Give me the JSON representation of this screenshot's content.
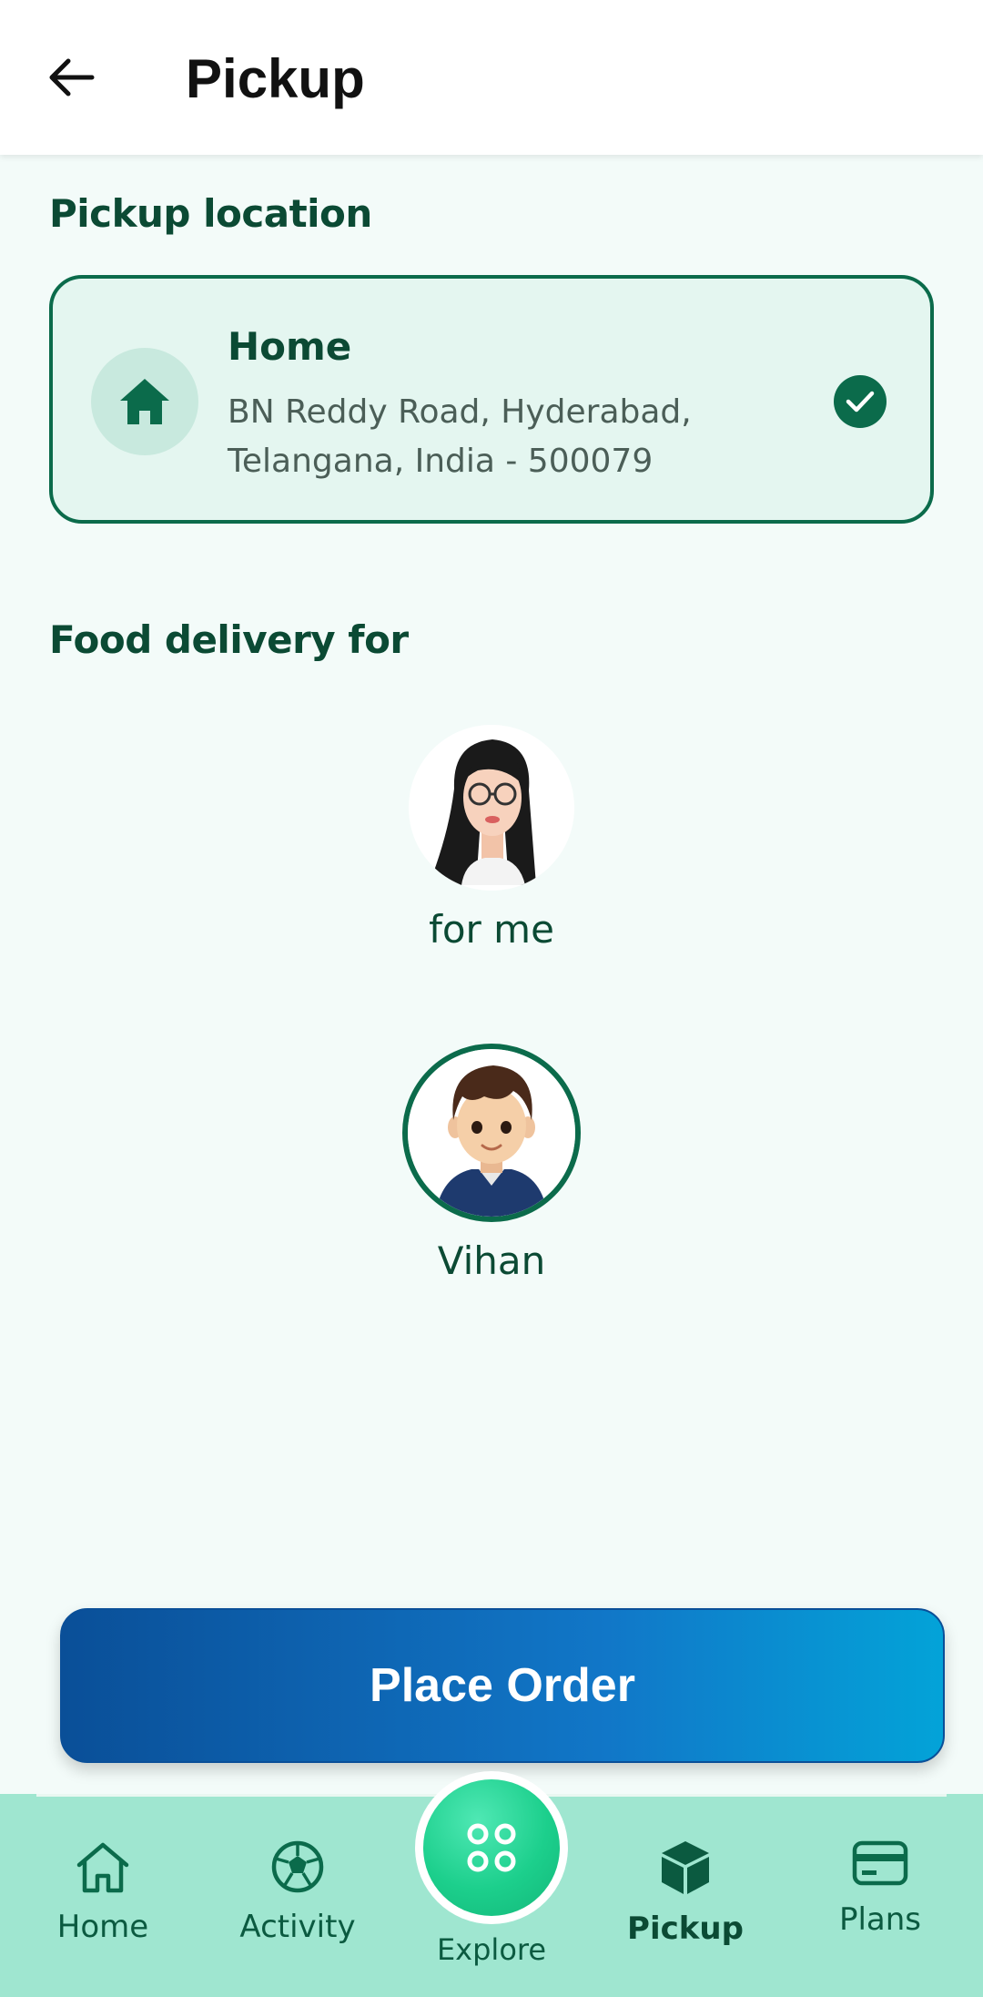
{
  "header": {
    "title": "Pickup"
  },
  "pickup": {
    "section_title": "Pickup location",
    "address": {
      "name": "Home",
      "line1": "BN Reddy Road, Hyderabad,",
      "line2": "Telangana, India - 500079"
    }
  },
  "delivery": {
    "section_title": "Food delivery for",
    "profiles": [
      {
        "label": "for me",
        "selected": false
      },
      {
        "label": "Vihan",
        "selected": true
      }
    ]
  },
  "actions": {
    "place_order": "Place Order"
  },
  "nav": {
    "items": [
      {
        "label": "Home",
        "icon": "home-icon"
      },
      {
        "label": "Activity",
        "icon": "soccer-ball-icon"
      },
      {
        "label": "Explore",
        "icon": "explore-grid-icon"
      },
      {
        "label": "Pickup",
        "icon": "box-icon",
        "active": true
      },
      {
        "label": "Plans",
        "icon": "card-icon"
      }
    ]
  },
  "colors": {
    "primary": "#0b6b4b",
    "background": "#f3fbf9",
    "nav_background": "#9fe6d0",
    "button_start": "#0a4f98",
    "button_end": "#03a3d8"
  }
}
